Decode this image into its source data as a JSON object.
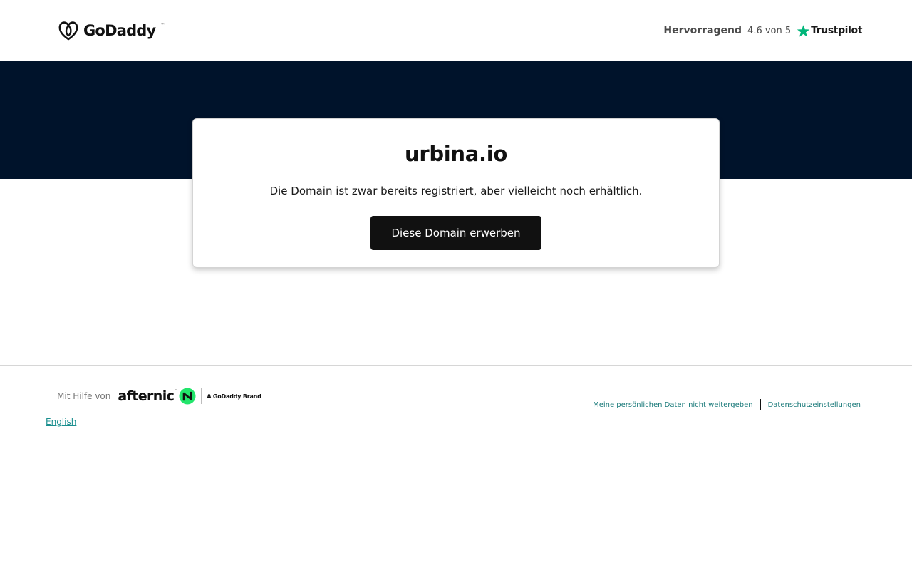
{
  "header": {
    "logo_text": "GoDaddy",
    "logo_tm": "™",
    "rating_label": "Hervorragend",
    "rating_score": "4.6 von 5",
    "trustpilot_text": "Trustpilot",
    "trustpilot_star_color": "#00b67a"
  },
  "colors": {
    "band": "#00132b",
    "button": "#111111",
    "link": "#1a8f8f",
    "afternic_green": "#22e56b"
  },
  "card": {
    "domain": "urbina.io",
    "message": "Die Domain ist zwar bereits registriert, aber vielleicht noch erhältlich.",
    "button_label": "Diese Domain erwerben"
  },
  "footer": {
    "powered_by": "Mit Hilfe von",
    "afternic_text": "afternic",
    "afternic_tm": "™",
    "brand_text": "A GoDaddy Brand",
    "language_link": "English",
    "legal_links": [
      "Meine persönlichen Daten nicht weitergeben",
      "Datenschutzeinstellungen"
    ]
  }
}
